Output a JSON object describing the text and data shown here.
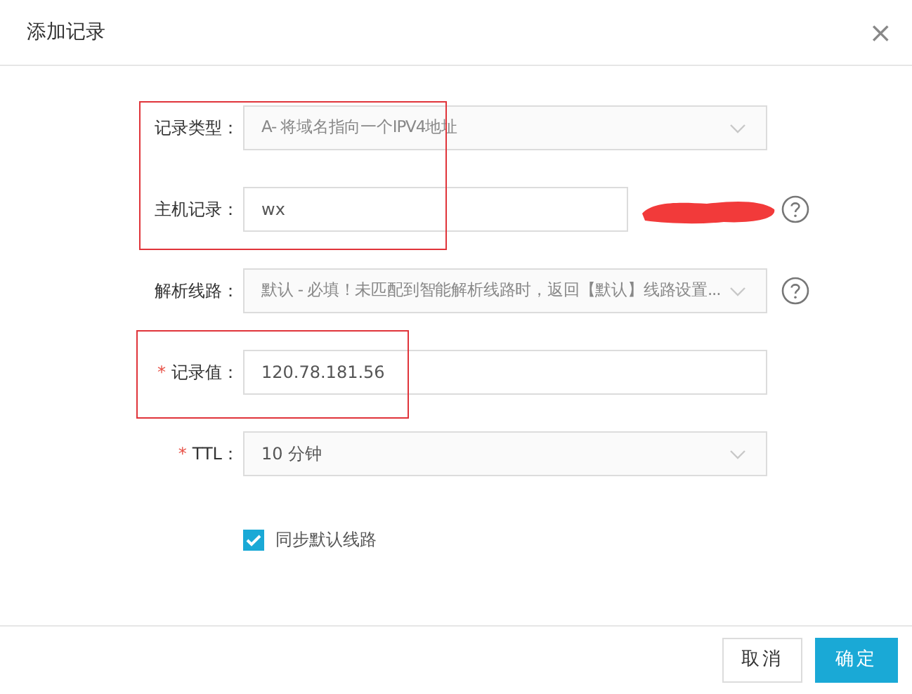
{
  "dialog": {
    "title": "添加记录",
    "close": "×"
  },
  "fields": [
    {
      "kind": "select",
      "label": "记录类型：",
      "value": "A- 将域名指向一个IPV4地址",
      "help": false
    },
    {
      "kind": "input",
      "label": "主机记录：",
      "value": "wx",
      "help": true
    },
    {
      "kind": "select",
      "label": "解析线路：",
      "value": "默认 - 必填！未匹配到智能解析线路时，返回【默认】线路设置...",
      "help": true
    },
    {
      "kind": "input",
      "label": "记录值：",
      "required_mark": "*",
      "value": "120.78.181.56",
      "help": false
    },
    {
      "kind": "select",
      "label": "TTL：",
      "required_mark": "*",
      "value": "10 分钟",
      "help": false
    }
  ],
  "sync": {
    "label": "同步默认线路",
    "checked": true
  },
  "buttons": [
    {
      "label": "取消",
      "primary": false
    },
    {
      "label": "确定",
      "primary": true
    }
  ]
}
